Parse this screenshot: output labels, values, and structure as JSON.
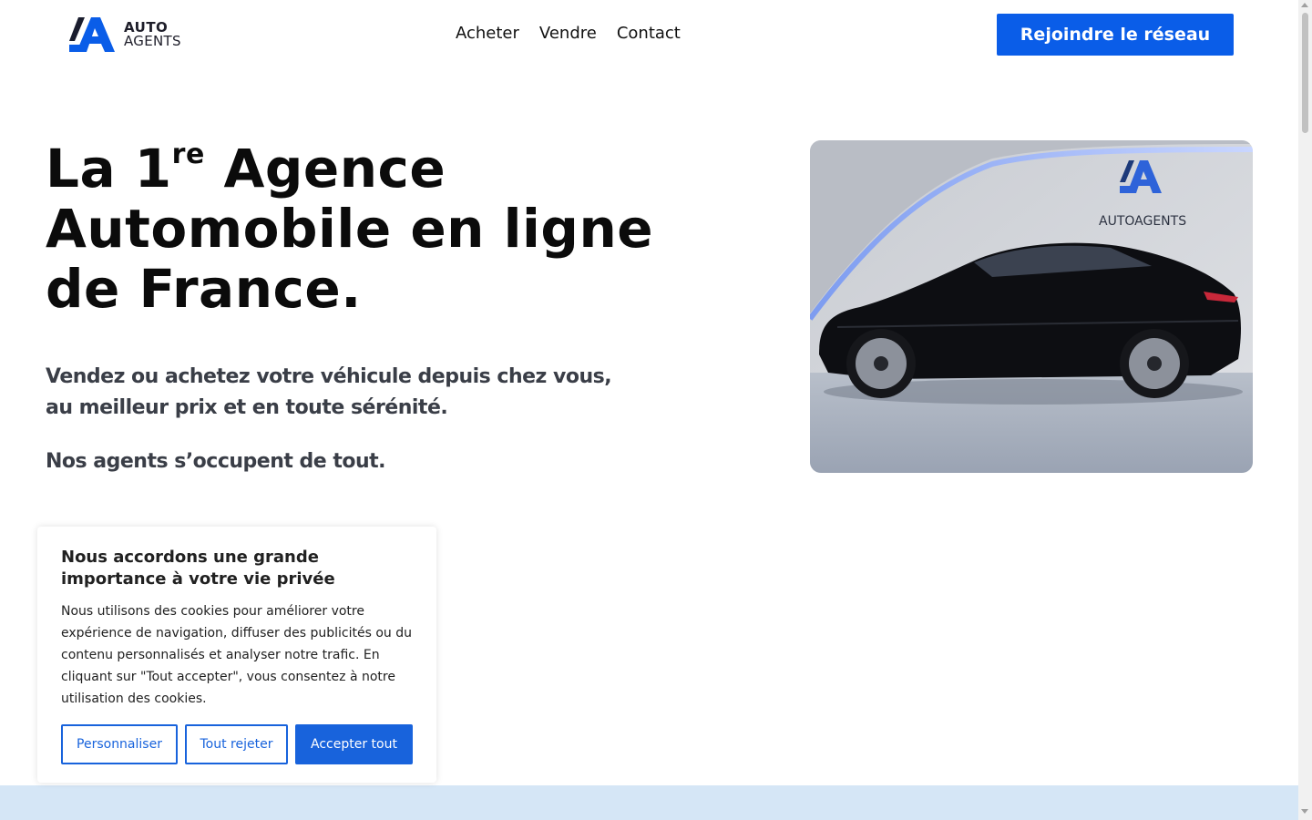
{
  "brand": {
    "line1": "AUTO",
    "line2": "AGENTS",
    "accent_color": "#0a5de8",
    "logo_icon": "auto-agents-logo-icon"
  },
  "nav": {
    "items": [
      {
        "label": "Acheter"
      },
      {
        "label": "Vendre"
      },
      {
        "label": "Contact"
      }
    ]
  },
  "header": {
    "cta_label": "Rejoindre le réseau"
  },
  "hero": {
    "title_part1": "La 1",
    "title_sup": "re",
    "title_part2": " Agence Automobile en ligne de France.",
    "subtitle": "Vendez ou achetez votre véhicule depuis chez vous, au meilleur prix et en toute sérénité.",
    "subtitle2": "Nos agents s’occupent de tout.",
    "image_logo_text": "AUTOAGENTS"
  },
  "cookie": {
    "title": "Nous accordons une grande importance à votre vie privée",
    "text": "Nous utilisons des cookies pour améliorer votre expérience de navigation, diffuser des publicités ou du contenu personnalisés et analyser notre trafic. En cliquant sur \"Tout accepter\", vous consentez à notre utilisation des cookies.",
    "customize_label": "Personnaliser",
    "reject_label": "Tout rejeter",
    "accept_label": "Accepter tout",
    "button_color": "#1863dc"
  }
}
